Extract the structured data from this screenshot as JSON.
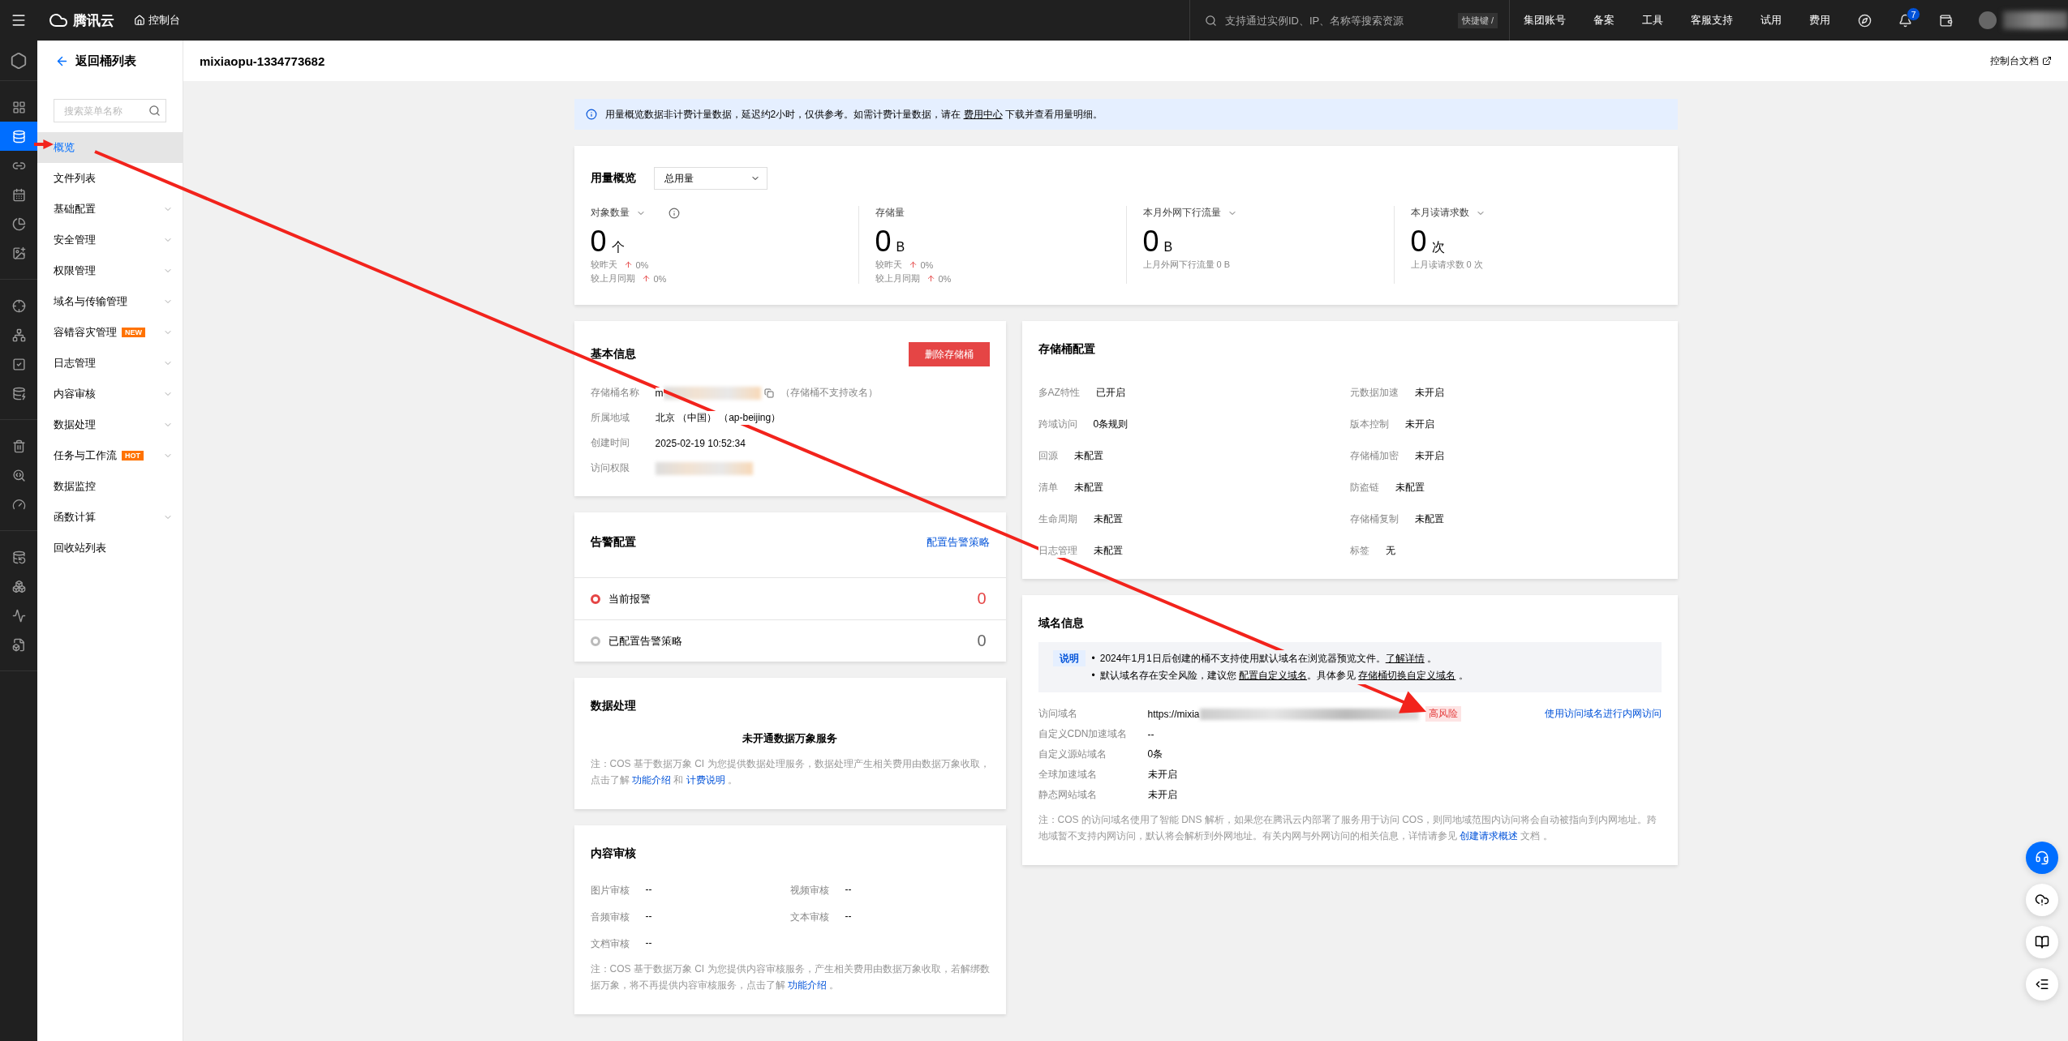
{
  "topbar": {
    "logo_text": "腾讯云",
    "console": "控制台",
    "search_placeholder": "支持通过实例ID、IP、名称等搜索资源",
    "shortcut": "快捷键 /",
    "nav": [
      "集团账号",
      "备案",
      "工具",
      "客服支持",
      "试用",
      "费用"
    ],
    "notification_count": "7"
  },
  "rail_groups": [
    {
      "items": [
        {
          "selected": false
        },
        {
          "selected": true
        },
        {
          "selected": false
        },
        {
          "selected": false
        },
        {
          "selected": false
        },
        {
          "selected": false
        }
      ]
    },
    {
      "items": [
        {
          "selected": false
        },
        {
          "selected": false
        },
        {
          "selected": false
        },
        {
          "selected": false
        }
      ]
    },
    {
      "items": [
        {
          "selected": false
        },
        {
          "selected": false
        },
        {
          "selected": false
        }
      ]
    },
    {
      "items": [
        {
          "selected": false
        },
        {
          "selected": false
        },
        {
          "selected": false
        },
        {
          "selected": false
        }
      ]
    }
  ],
  "sidebar": {
    "back": "返回桶列表",
    "search_placeholder": "搜索菜单名称",
    "items": [
      {
        "label": "概览",
        "selected": true,
        "expandable": false
      },
      {
        "label": "文件列表",
        "selected": false,
        "expandable": false
      },
      {
        "label": "基础配置",
        "selected": false,
        "expandable": true
      },
      {
        "label": "安全管理",
        "selected": false,
        "expandable": true
      },
      {
        "label": "权限管理",
        "selected": false,
        "expandable": true
      },
      {
        "label": "域名与传输管理",
        "selected": false,
        "expandable": true
      },
      {
        "label": "容错容灾管理",
        "selected": false,
        "expandable": true,
        "badge": "NEW"
      },
      {
        "label": "日志管理",
        "selected": false,
        "expandable": true
      },
      {
        "label": "内容审核",
        "selected": false,
        "expandable": true
      },
      {
        "label": "数据处理",
        "selected": false,
        "expandable": true
      },
      {
        "label": "任务与工作流",
        "selected": false,
        "expandable": true,
        "badge": "HOT"
      },
      {
        "label": "数据监控",
        "selected": false,
        "expandable": false
      },
      {
        "label": "函数计算",
        "selected": false,
        "expandable": true
      },
      {
        "label": "回收站列表",
        "selected": false,
        "expandable": false
      }
    ]
  },
  "header": {
    "title": "mixiaopu-1334773682",
    "doc_link": "控制台文档"
  },
  "notice": [
    {
      "kind": "text",
      "text": "用量概览数据非计费计量数据，延迟约2小时，仅供参考。如需计费计量数据，请在 "
    },
    {
      "kind": "doc_link",
      "text": "费用中心"
    },
    {
      "kind": "text",
      "text": " 下载并查看用量明细。"
    }
  ],
  "usage": {
    "title": "用量概览",
    "select": "总用量",
    "metrics": [
      {
        "label": "对象数量",
        "icons": [
          {
            "kind": "caret"
          },
          {
            "kind": "info"
          }
        ],
        "value": "0",
        "unit": "个",
        "lines": [
          {
            "kind": "trend",
            "label": "较昨天",
            "value": "0%"
          },
          {
            "kind": "trend",
            "label": "较上月同期",
            "value": "0%"
          }
        ]
      },
      {
        "label": "存储量",
        "value": "0",
        "unit": "B",
        "lines": [
          {
            "kind": "trend",
            "label": "较昨天",
            "value": "0%"
          },
          {
            "kind": "trend",
            "label": "较上月同期",
            "value": "0%"
          }
        ]
      },
      {
        "label": "本月外网下行流量",
        "icons": [
          {
            "kind": "caret"
          }
        ],
        "value": "0",
        "unit": "B",
        "lines": [
          {
            "kind": "plain",
            "label": "上月外网下行流量 0 B"
          }
        ]
      },
      {
        "label": "本月读请求数",
        "icons": [
          {
            "kind": "caret"
          }
        ],
        "value": "0",
        "unit": "次",
        "lines": [
          {
            "kind": "plain",
            "label": "上月读请求数 0 次"
          }
        ]
      }
    ]
  },
  "basic_info": {
    "title": "基本信息",
    "delete_button": "删除存储桶",
    "rows": [
      {
        "kind": "copyable",
        "label": "存储桶名称",
        "value": "m",
        "note": "（存储桶不支持改名）"
      },
      {
        "kind": "text",
        "label": "所属地域",
        "value": "北京 （中国） （ap-beijing）"
      },
      {
        "kind": "text",
        "label": "创建时间",
        "value": "2025-02-19 10:52:34"
      },
      {
        "kind": "hidden",
        "label": "访问权限"
      }
    ]
  },
  "alarm": {
    "title": "告警配置",
    "link": "配置告警策略",
    "rows": [
      {
        "label": "当前报警",
        "count": "0",
        "active": true
      },
      {
        "label": "已配置告警策略",
        "count": "0",
        "active": false
      }
    ]
  },
  "data_processing": {
    "title": "数据处理",
    "status": "未开通数据万象服务",
    "note": [
      {
        "kind": "text",
        "text": "注：COS 基于数据万象 CI 为您提供数据处理服务，数据处理产生相关费用由数据万象收取，点击了解 "
      },
      {
        "kind": "link",
        "text": "功能介绍"
      },
      {
        "kind": "text",
        "text": " 和 "
      },
      {
        "kind": "link",
        "text": "计费说明"
      },
      {
        "kind": "text",
        "text": " 。"
      }
    ]
  },
  "content_review": {
    "title": "内容审核",
    "items": [
      {
        "label": "图片审核",
        "value": "--"
      },
      {
        "label": "视频审核",
        "value": "--"
      },
      {
        "label": "音频审核",
        "value": "--"
      },
      {
        "label": "文本审核",
        "value": "--"
      },
      {
        "label": "文档审核",
        "value": "--"
      }
    ],
    "note": [
      {
        "kind": "text",
        "text": "注：COS 基于数据万象 CI 为您提供内容审核服务，产生相关费用由数据万象收取，若解绑数据万象，将不再提供内容审核服务，点击了解 "
      },
      {
        "kind": "link",
        "text": "功能介绍"
      },
      {
        "kind": "text",
        "text": " 。"
      }
    ]
  },
  "storage_config": {
    "title": "存储桶配置",
    "items": [
      {
        "label": "多AZ特性",
        "value": "已开启"
      },
      {
        "label": "元数据加速",
        "value": "未开启"
      },
      {
        "label": "跨域访问",
        "value": "0条规则"
      },
      {
        "label": "版本控制",
        "value": "未开启"
      },
      {
        "label": "回源",
        "value": "未配置"
      },
      {
        "label": "存储桶加密",
        "value": "未开启"
      },
      {
        "label": "清单",
        "value": "未配置"
      },
      {
        "label": "防盗链",
        "value": "未配置"
      },
      {
        "label": "生命周期",
        "value": "未配置"
      },
      {
        "label": "存储桶复制",
        "value": "未配置"
      },
      {
        "label": "日志管理",
        "value": "未配置"
      },
      {
        "label": "标签",
        "value": "无"
      }
    ]
  },
  "domain_info": {
    "title": "域名信息",
    "notice_tag": "说明",
    "bullets": [
      {
        "marker": "•",
        "segments": [
          {
            "kind": "text",
            "text": "2024年1月1日后创建的桶不支持使用默认域名在浏览器预览文件。"
          },
          {
            "kind": "doc_link",
            "text": "了解详情"
          },
          {
            "kind": "text",
            "text": " 。"
          }
        ]
      },
      {
        "marker": "•",
        "segments": [
          {
            "kind": "text",
            "text": "默认域名存在安全风险，建议您 "
          },
          {
            "kind": "doc_link",
            "text": "配置自定义域名"
          },
          {
            "kind": "text",
            "text": "。具体参见 "
          },
          {
            "kind": "doc_link",
            "text": "存储桶切换自定义域名"
          },
          {
            "kind": "text",
            "text": " 。"
          }
        ]
      }
    ],
    "rows": [
      {
        "kind": "url",
        "label": "访问域名",
        "value": "https://mixia",
        "risk": "高风险",
        "action": "使用访问域名进行内网访问"
      },
      {
        "kind": "text",
        "label": "自定义CDN加速域名",
        "value": "--"
      },
      {
        "kind": "text",
        "label": "自定义源站域名",
        "value": "0条"
      },
      {
        "kind": "text",
        "label": "全球加速域名",
        "value": "未开启"
      },
      {
        "kind": "text",
        "label": "静态网站域名",
        "value": "未开启"
      }
    ],
    "note": [
      {
        "kind": "text",
        "text": "注：COS 的访问域名使用了智能 DNS 解析，如果您在腾讯云内部署了服务用于访问 COS，则同地域范围内访问将会自动被指向到内网地址。跨地域暂不支持内网访问，默认将会解析到外网地址。有关内网与外网访问的相关信息，详情请参见 "
      },
      {
        "kind": "link",
        "text": "创建请求概述"
      },
      {
        "kind": "text",
        "text": " 文档 。"
      }
    ]
  },
  "float_buttons": [
    {
      "primary": true
    },
    {
      "primary": false
    },
    {
      "primary": false
    },
    {
      "primary": false
    }
  ]
}
